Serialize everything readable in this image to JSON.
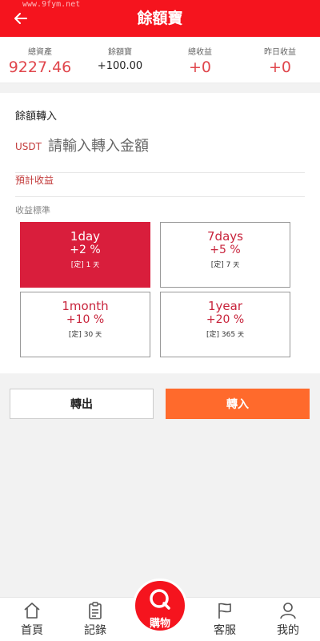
{
  "header": {
    "title": "餘額寶",
    "watermark": "www.9fym.net"
  },
  "stats": [
    {
      "label": "總資產",
      "value": "9227.46"
    },
    {
      "label": "餘額寶",
      "value": "+100.00"
    },
    {
      "label": "總收益",
      "value": "+0"
    },
    {
      "label": "昨日收益",
      "value": "+0"
    }
  ],
  "transfer": {
    "title": "餘額轉入",
    "currency": "USDT",
    "amount_placeholder": "請輸入轉入金額",
    "forecast_label": "預計收益",
    "rate_label": "收益標準"
  },
  "plans": [
    {
      "name": "1day",
      "rate": "+2 %",
      "term_prefix": "[定]",
      "term_value": "1",
      "term_unit": "天"
    },
    {
      "name": "7days",
      "rate": "+5 %",
      "term_prefix": "[定]",
      "term_value": "7",
      "term_unit": "天"
    },
    {
      "name": "1month",
      "rate": "+10 %",
      "term_prefix": "[定]",
      "term_value": "30",
      "term_unit": "天"
    },
    {
      "name": "1year",
      "rate": "+20 %",
      "term_prefix": "[定]",
      "term_value": "365",
      "term_unit": "天"
    }
  ],
  "buttons": {
    "out_label": "轉出",
    "in_label": "轉入"
  },
  "tabbar": {
    "home": "首頁",
    "records": "記錄",
    "shop": "購物",
    "service": "客服",
    "mine": "我的"
  },
  "colors": {
    "brand": "#f5141e",
    "accent_orange": "#ff6a2c",
    "active_plan": "#d91e3c"
  }
}
